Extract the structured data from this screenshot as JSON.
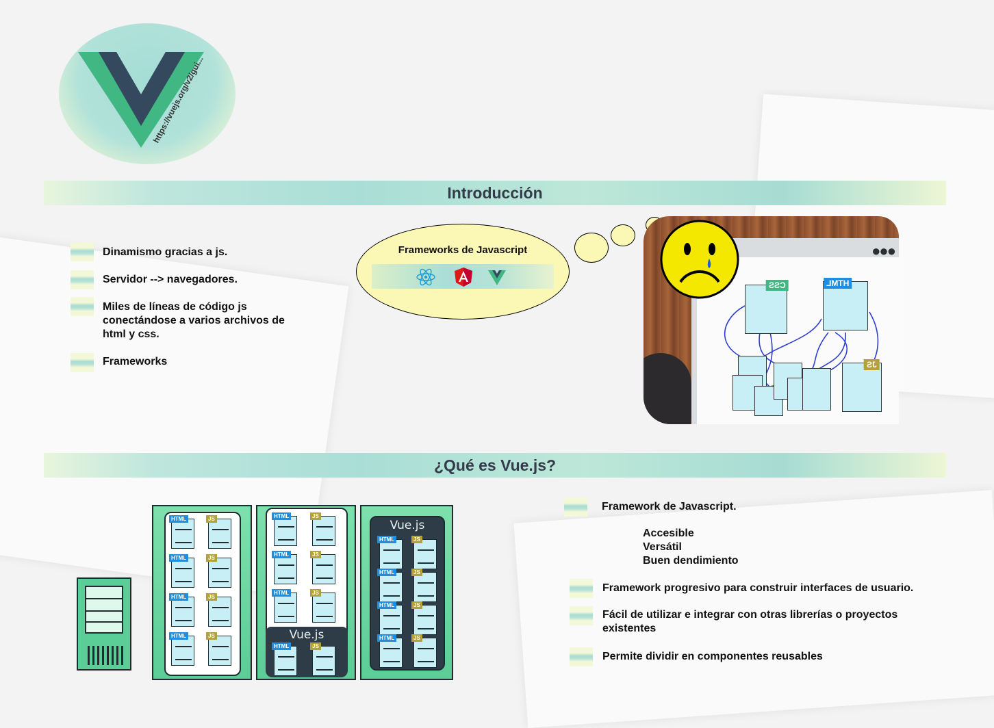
{
  "logo": {
    "url_text": "https://vuejs.org/v2/gui..."
  },
  "section1": {
    "title": "Introducción",
    "bullets": [
      "Dinamismo gracias a js.",
      "Servidor --> navegadores.",
      "Miles de líneas de código js conectándose a varios archivos de html y css.",
      "Frameworks"
    ],
    "bubble": {
      "title": "Frameworks de Javascript",
      "icons": [
        "react-icon",
        "angular-icon",
        "vue-icon"
      ]
    },
    "illustration": {
      "css_tag": "CSS",
      "html_tag": "HTML",
      "js_tag": "JS"
    }
  },
  "section2": {
    "title": "¿Qué es Vue.js?",
    "bullets": [
      "Framework de Javascript.",
      "Framework progresivo para construir interfaces de usuario.",
      "Fácil de utilizar e integrar con otras librerías o proyectos existentes",
      "Permite dividir en componentes reusables"
    ],
    "sub_items": [
      "Accesible",
      "Versátil",
      "Buen dendimiento"
    ],
    "panels": {
      "html_tag": "HTML",
      "js_tag": "JS",
      "vue_label": "Vue.js"
    }
  },
  "colors": {
    "vue_green": "#41b883",
    "vue_dark": "#35495e",
    "banner": "#a9ded6",
    "bubble": "#fbf7b4"
  }
}
